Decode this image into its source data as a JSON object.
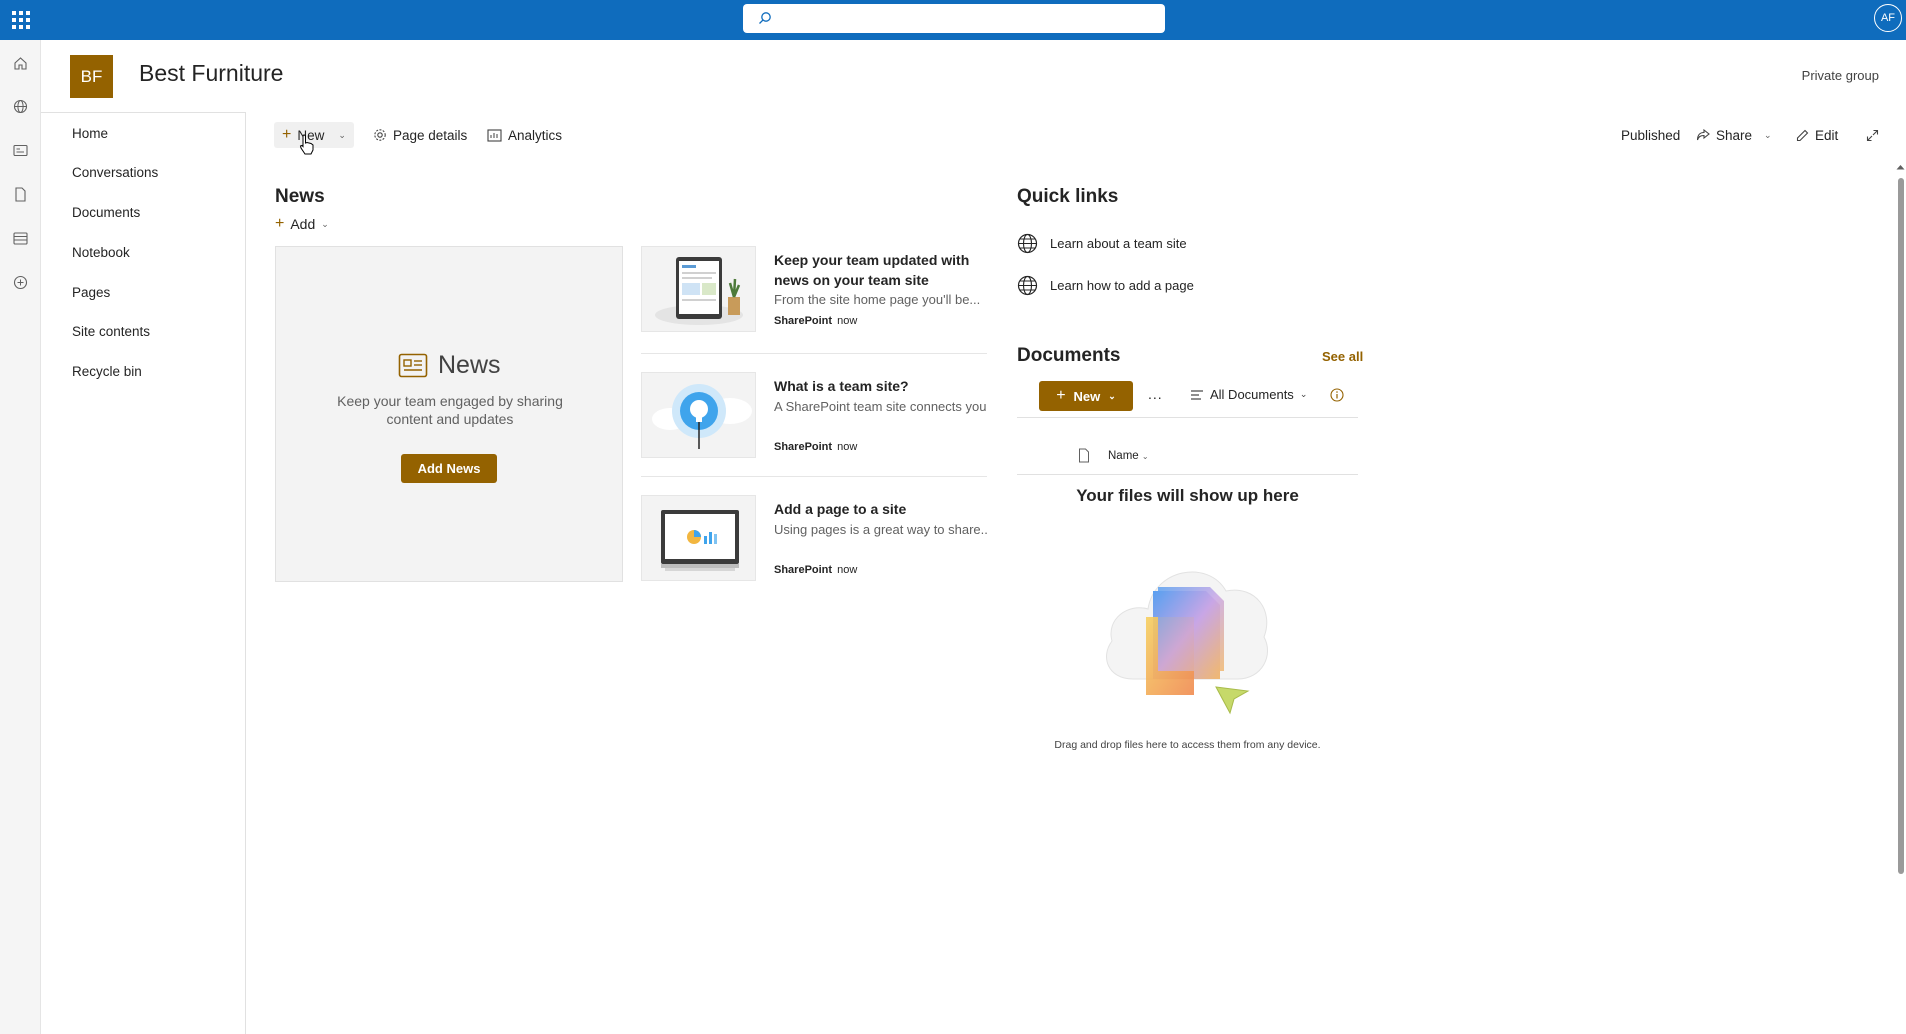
{
  "suite": {
    "search_placeholder": "",
    "user_initials": "AF"
  },
  "site": {
    "logo_initials": "BF",
    "title": "Best Furniture",
    "privacy": "Private group"
  },
  "nav": {
    "items": [
      "Home",
      "Conversations",
      "Documents",
      "Notebook",
      "Pages",
      "Site contents",
      "Recycle bin"
    ]
  },
  "cmdbar": {
    "new_label": "New",
    "page_details_label": "Page details",
    "analytics_label": "Analytics",
    "published_label": "Published",
    "share_label": "Share",
    "edit_label": "Edit"
  },
  "news": {
    "heading": "News",
    "add_label": "Add",
    "empty_title": "News",
    "empty_desc": "Keep your team engaged by sharing content and updates",
    "add_news_label": "Add News",
    "items": [
      {
        "title": "Keep your team updated with news on your team site",
        "desc": "From the site home page you'll be...",
        "author": "SharePoint",
        "time": "now"
      },
      {
        "title": "What is a team site?",
        "desc": "A SharePoint team site connects you...",
        "author": "SharePoint",
        "time": "now"
      },
      {
        "title": "Add a page to a site",
        "desc": "Using pages is a great way to share...",
        "author": "SharePoint",
        "time": "now"
      }
    ]
  },
  "quicklinks": {
    "heading": "Quick links",
    "items": [
      "Learn about a team site",
      "Learn how to add a page"
    ]
  },
  "documents": {
    "heading": "Documents",
    "see_all": "See all",
    "new_label": "New",
    "more_label": "...",
    "view_label": "All Documents",
    "col_name": "Name",
    "empty_title": "Your files will show up here",
    "empty_desc": "Drag and drop files here to access them from any device."
  },
  "colors": {
    "suitebar": "#0f6cbd",
    "accent": "#946200"
  }
}
